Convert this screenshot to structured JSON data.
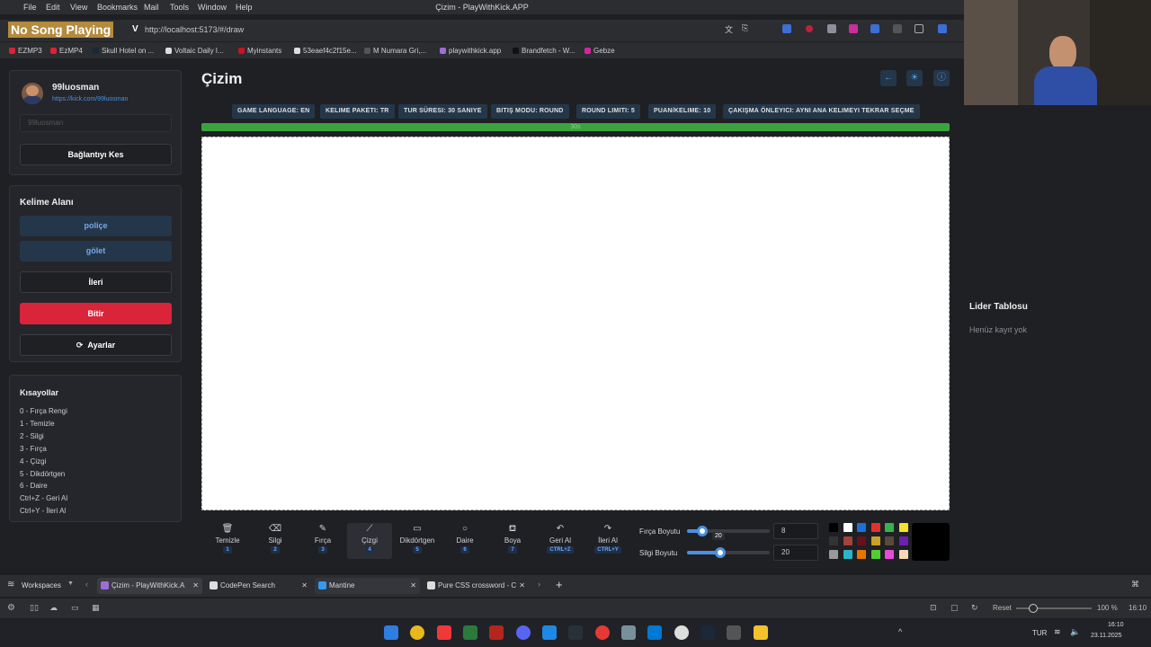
{
  "browser": {
    "menu": [
      "File",
      "Edit",
      "View",
      "Bookmarks",
      "Mail",
      "Tools",
      "Window",
      "Help"
    ],
    "window_title": "Çizim - PlayWithKick.APP",
    "url": "http://localhost:5173/#/draw",
    "overlay_text": "No Song Playing",
    "bookmarks": [
      "EZMP3",
      "EzMP4",
      "Skull Hotel on ...",
      "Voltaic Daily I...",
      "Myinstants",
      "53eaef4c2f15e...",
      "M Numara Gri,...",
      "playwithkick.app",
      "Brandfetch - W...",
      "Gebze"
    ]
  },
  "profile": {
    "username": "99luosman",
    "link": "https://kick.com/99luosman",
    "input_placeholder": "99luosman",
    "disconnect_label": "Bağlantıyı Kes"
  },
  "word_area": {
    "title": "Kelime Alanı",
    "words": [
      "poliçe",
      "gölet"
    ],
    "next_label": "İleri",
    "finish_label": "Bitir",
    "settings_label": "Ayarlar"
  },
  "shortcuts": {
    "title": "Kısayollar",
    "items": [
      "0 - Fırça Rengi",
      "1 - Temizle",
      "2 - Silgi",
      "3 - Fırça",
      "4 - Çizgi",
      "5 - Dikdörtgen",
      "6 - Daire",
      "Ctrl+Z - Geri Al",
      "Ctrl+Y - İleri Al"
    ]
  },
  "main": {
    "title": "Çizim",
    "settings_chips": [
      "GAME LANGUAGE: EN",
      "KELIME PAKETI: TR",
      "TUR SÜRESI: 30 SANIYE",
      "BITIŞ MODU: ROUND",
      "ROUND LIMITI: 5",
      "PUAN/KELIME: 10",
      "ÇAKIŞMA ÖNLEYICI: AYNI ANA KELIMEYI TEKRAR SEÇME"
    ],
    "timer_text": "30s",
    "timer_progress": 1.0
  },
  "toolbar": {
    "tools": [
      {
        "label": "Temizle",
        "key": "1",
        "glyph": "🗑"
      },
      {
        "label": "Silgi",
        "key": "2",
        "glyph": "⌫"
      },
      {
        "label": "Fırça",
        "key": "3",
        "glyph": "✎"
      },
      {
        "label": "Çizgi",
        "key": "4",
        "glyph": "⟋"
      },
      {
        "label": "Dikdörtgen",
        "key": "5",
        "glyph": "▭"
      },
      {
        "label": "Daire",
        "key": "6",
        "glyph": "○"
      },
      {
        "label": "Boya",
        "key": "7",
        "glyph": "⛾"
      },
      {
        "label": "Geri Al",
        "key": "CTRL+Z",
        "glyph": "↶"
      },
      {
        "label": "İleri Al",
        "key": "CTRL+Y",
        "glyph": "↷"
      }
    ],
    "active_tool": "Çizgi",
    "brush_size_label": "Fırça Boyutu",
    "brush_size": "8",
    "brush_size_fraction": 0.19,
    "eraser_size_label": "Silgi Boyutu",
    "eraser_size": "20",
    "eraser_size_fraction": 0.4,
    "tooltip_value": "20",
    "palette": [
      "#000000",
      "#ffffff",
      "#1e6fd9",
      "#e03131",
      "#37b24d",
      "#f5e12f",
      "#333333",
      "#a5423a",
      "#6b0f1a",
      "#c9a227",
      "#5a4a3a",
      "#6c1fb0",
      "#999999",
      "#2bb5c8",
      "#e67700",
      "#51cf2f",
      "#e64bd8",
      "#f7d9b8"
    ],
    "current_color": "#000000"
  },
  "leaderboard": {
    "title": "Lider Tablosu",
    "empty_text": "Henüz kayıt yok"
  },
  "tabs": {
    "workspaces": "Workspaces",
    "items": [
      "Çizim - PlayWithKick.A",
      "CodePen Search",
      "Mantine",
      "Pure CSS crossword - C"
    ]
  },
  "status": {
    "reset": "Reset",
    "zoom": "100 %",
    "time": "16:10"
  },
  "taskbar": {
    "lang": "TUR",
    "clock_time": "16:10",
    "clock_date": "23.11.2025"
  }
}
